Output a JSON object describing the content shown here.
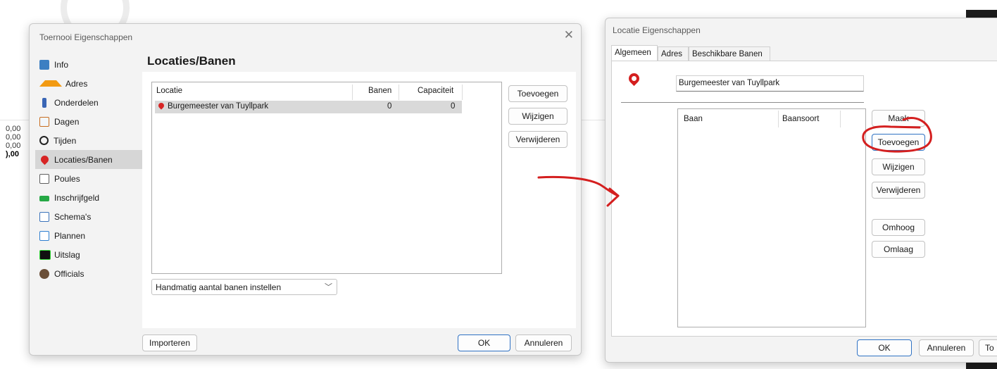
{
  "background": {
    "numbers": [
      "0,00",
      "0,00",
      "0,00",
      "),00"
    ]
  },
  "dialog1": {
    "title": "Toernooi Eigenschappen",
    "close_glyph": "✕",
    "nav": [
      {
        "label": "Info",
        "icon": "info-icon"
      },
      {
        "label": "Adres",
        "icon": "home-icon"
      },
      {
        "label": "Onderdelen",
        "icon": "parts-icon"
      },
      {
        "label": "Dagen",
        "icon": "calendar-icon"
      },
      {
        "label": "Tijden",
        "icon": "clock-icon"
      },
      {
        "label": "Locaties/Banen",
        "icon": "location-pin-icon",
        "active": true
      },
      {
        "label": "Poules",
        "icon": "dice-icon"
      },
      {
        "label": "Inschrijfgeld",
        "icon": "money-icon"
      },
      {
        "label": "Schema's",
        "icon": "schema-icon"
      },
      {
        "label": "Plannen",
        "icon": "planning-icon"
      },
      {
        "label": "Uitslag",
        "icon": "scoreboard-icon"
      },
      {
        "label": "Officials",
        "icon": "user-icon"
      }
    ],
    "page_title": "Locaties/Banen",
    "table": {
      "headers": [
        "Locatie",
        "Banen",
        "Capaciteit"
      ],
      "rows": [
        {
          "locatie": "Burgemeester van Tuyllpark",
          "banen": "0",
          "capaciteit": "0",
          "selected": true
        }
      ]
    },
    "buttons": {
      "toevoegen": "Toevoegen",
      "wijzigen": "Wijzigen",
      "verwijderen": "Verwijderen",
      "importeren": "Importeren",
      "ok": "OK",
      "annuleren": "Annuleren"
    },
    "combo": {
      "value": "Handmatig aantal banen instellen",
      "chevron": "﹀"
    }
  },
  "dialog2": {
    "title": "Locatie Eigenschappen",
    "tabs": [
      "Algemeen",
      "Adres",
      "Beschikbare Banen"
    ],
    "active_tab": "Algemeen",
    "name_value": "Burgemeester van Tuyllpark",
    "table": {
      "headers": [
        "Baan",
        "Baansoort"
      ],
      "rows": []
    },
    "buttons": {
      "maak": "Maak",
      "toevoegen": "Toevoegen",
      "wijzigen": "Wijzigen",
      "verwijderen": "Verwijderen",
      "omhoog": "Omhoog",
      "omlaag": "Omlaag",
      "ok": "OK",
      "annuleren": "Annuleren",
      "toepassen_partial": "To"
    }
  },
  "colors": {
    "accent_border": "#2f72c4",
    "annotation_red": "#d41f1f",
    "selected_row": "#d9d9d9",
    "dialog_bg": "#f3f3f3"
  }
}
